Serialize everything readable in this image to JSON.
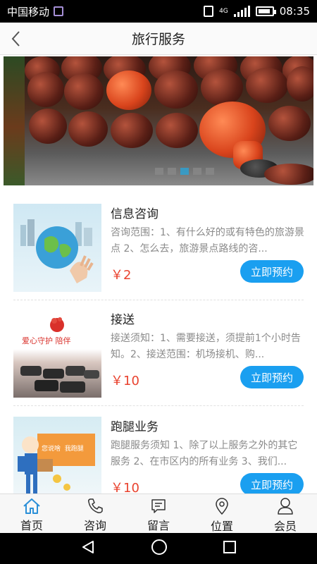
{
  "status_bar": {
    "carrier": "中国移动",
    "network": "4G",
    "time": "08:35"
  },
  "header": {
    "title": "旅行服务",
    "back_icon": "chevron-left-icon"
  },
  "banner": {
    "indicator_count": 5,
    "active_index": 2
  },
  "services": [
    {
      "name": "信息咨询",
      "desc": "咨询范围：1、有什么好的或有特色的旅游景点 2、怎么去，旅游景点路线的咨...",
      "price": "￥2",
      "button": "立即预约",
      "thumb_text": ""
    },
    {
      "name": "接送",
      "desc": "接送须知：1、需要接送，须提前1个小时告知。2、接送范围：机场接机、购...",
      "price": "￥10",
      "button": "立即预约",
      "thumb_text": "爱心守护 陪伴"
    },
    {
      "name": "跑腿业务",
      "desc": "跑腿服务须知 1、除了以上服务之外的其它服务 2、在市区内的所有业务 3、我们...",
      "price": "￥10",
      "button": "立即预约",
      "thumb_text": "您说啥  我跑腿"
    }
  ],
  "tabs": [
    {
      "label": "首页",
      "icon": "home-icon",
      "active": true
    },
    {
      "label": "咨询",
      "icon": "phone-icon",
      "active": false
    },
    {
      "label": "留言",
      "icon": "message-icon",
      "active": false
    },
    {
      "label": "位置",
      "icon": "location-pin-icon",
      "active": false
    },
    {
      "label": "会员",
      "icon": "user-icon",
      "active": false
    }
  ],
  "colors": {
    "accent": "#1a9ff0",
    "price": "#e9432f",
    "tab_active": "#2b8fd8"
  }
}
